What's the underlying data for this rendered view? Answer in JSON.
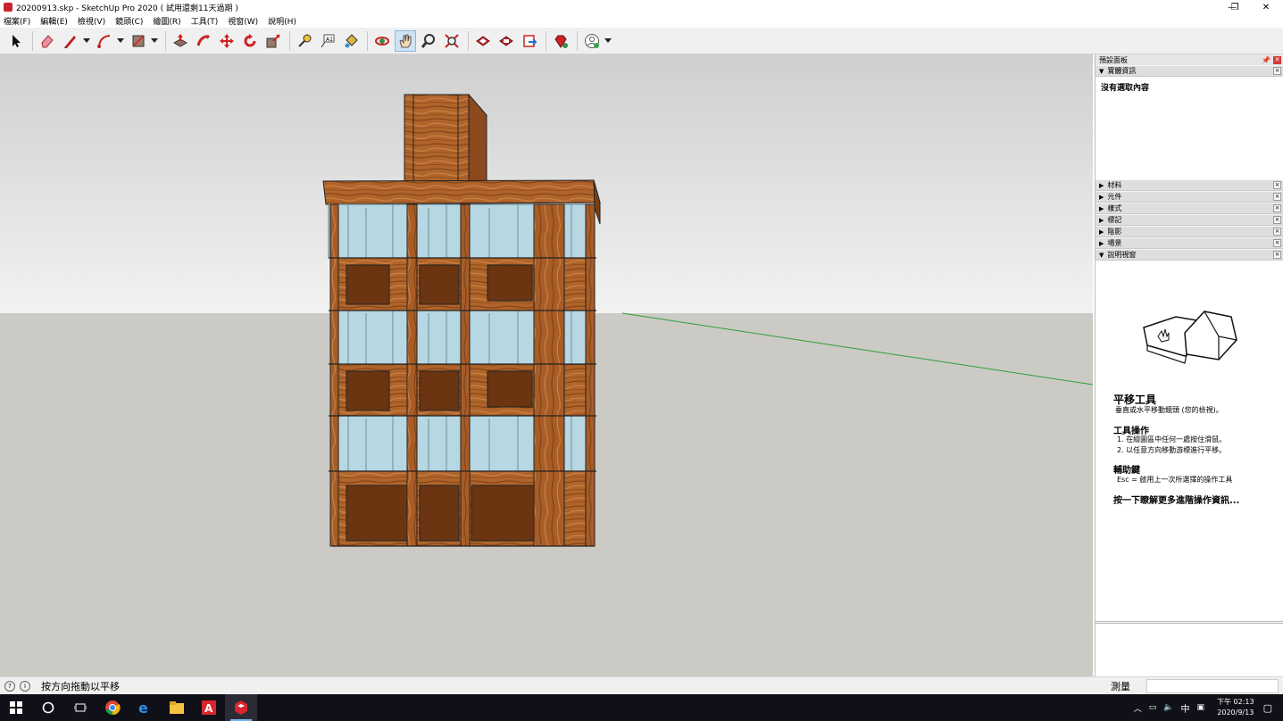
{
  "window": {
    "title": "20200913.skp - SketchUp Pro 2020 ( 試用還剩11天過期 )",
    "minimize": "—",
    "restore": "❐",
    "close": "✕"
  },
  "menu": [
    "檔案(F)",
    "編輯(E)",
    "檢視(V)",
    "鏡頭(C)",
    "繪圖(R)",
    "工具(T)",
    "視窗(W)",
    "說明(H)"
  ],
  "toolbar": {
    "tools": [
      "select",
      "eraser",
      "line",
      "arc",
      "shape",
      "push-pull",
      "follow-me",
      "move",
      "rotate",
      "scale",
      "tape-measure",
      "text",
      "paint-bucket",
      "orbit",
      "pan",
      "zoom",
      "zoom-extents",
      "3d-warehouse",
      "extension-warehouse",
      "send-to-layout",
      "extension-manager",
      "account"
    ],
    "active_tool": "pan"
  },
  "colors": {
    "sky": "#d9d9d9",
    "ground": "#cbcac5",
    "wood": "#b0642a",
    "glass": "#b7d7e3",
    "green_axis": "#2e9f38"
  },
  "tray": {
    "title": "預設面板",
    "entity_info": {
      "label": "實體資訊",
      "content": "沒有選取內容"
    },
    "panels": [
      "材料",
      "元件",
      "樣式",
      "標記",
      "陰影",
      "場景"
    ],
    "instructor": {
      "label": "說明視窗",
      "tool_title": "平移工具",
      "tool_desc": "垂直或水平移動鏡頭 (您的檢視)。",
      "ops_title": "工具操作",
      "ops": [
        "1. 在繪圖區中任何一處按住滑鼠。",
        "2. 以任意方向移動游標進行平移。"
      ],
      "keys_title": "輔助鍵",
      "keys": [
        "Esc = 啟用上一次所選擇的操作工具"
      ],
      "more_link": "按一下瞭解更多進階操作資訊..."
    }
  },
  "status": {
    "hint": "按方向拖動以平移",
    "measure_label": "測量",
    "measure_value": ""
  },
  "taskbar": {
    "apps": [
      "start",
      "cortana",
      "task-view",
      "chrome",
      "edge",
      "file-explorer",
      "autocad",
      "sketchup"
    ],
    "active_app": "sketchup",
    "ime": "中",
    "time": "下午 02:13",
    "date": "2020/9/13"
  }
}
